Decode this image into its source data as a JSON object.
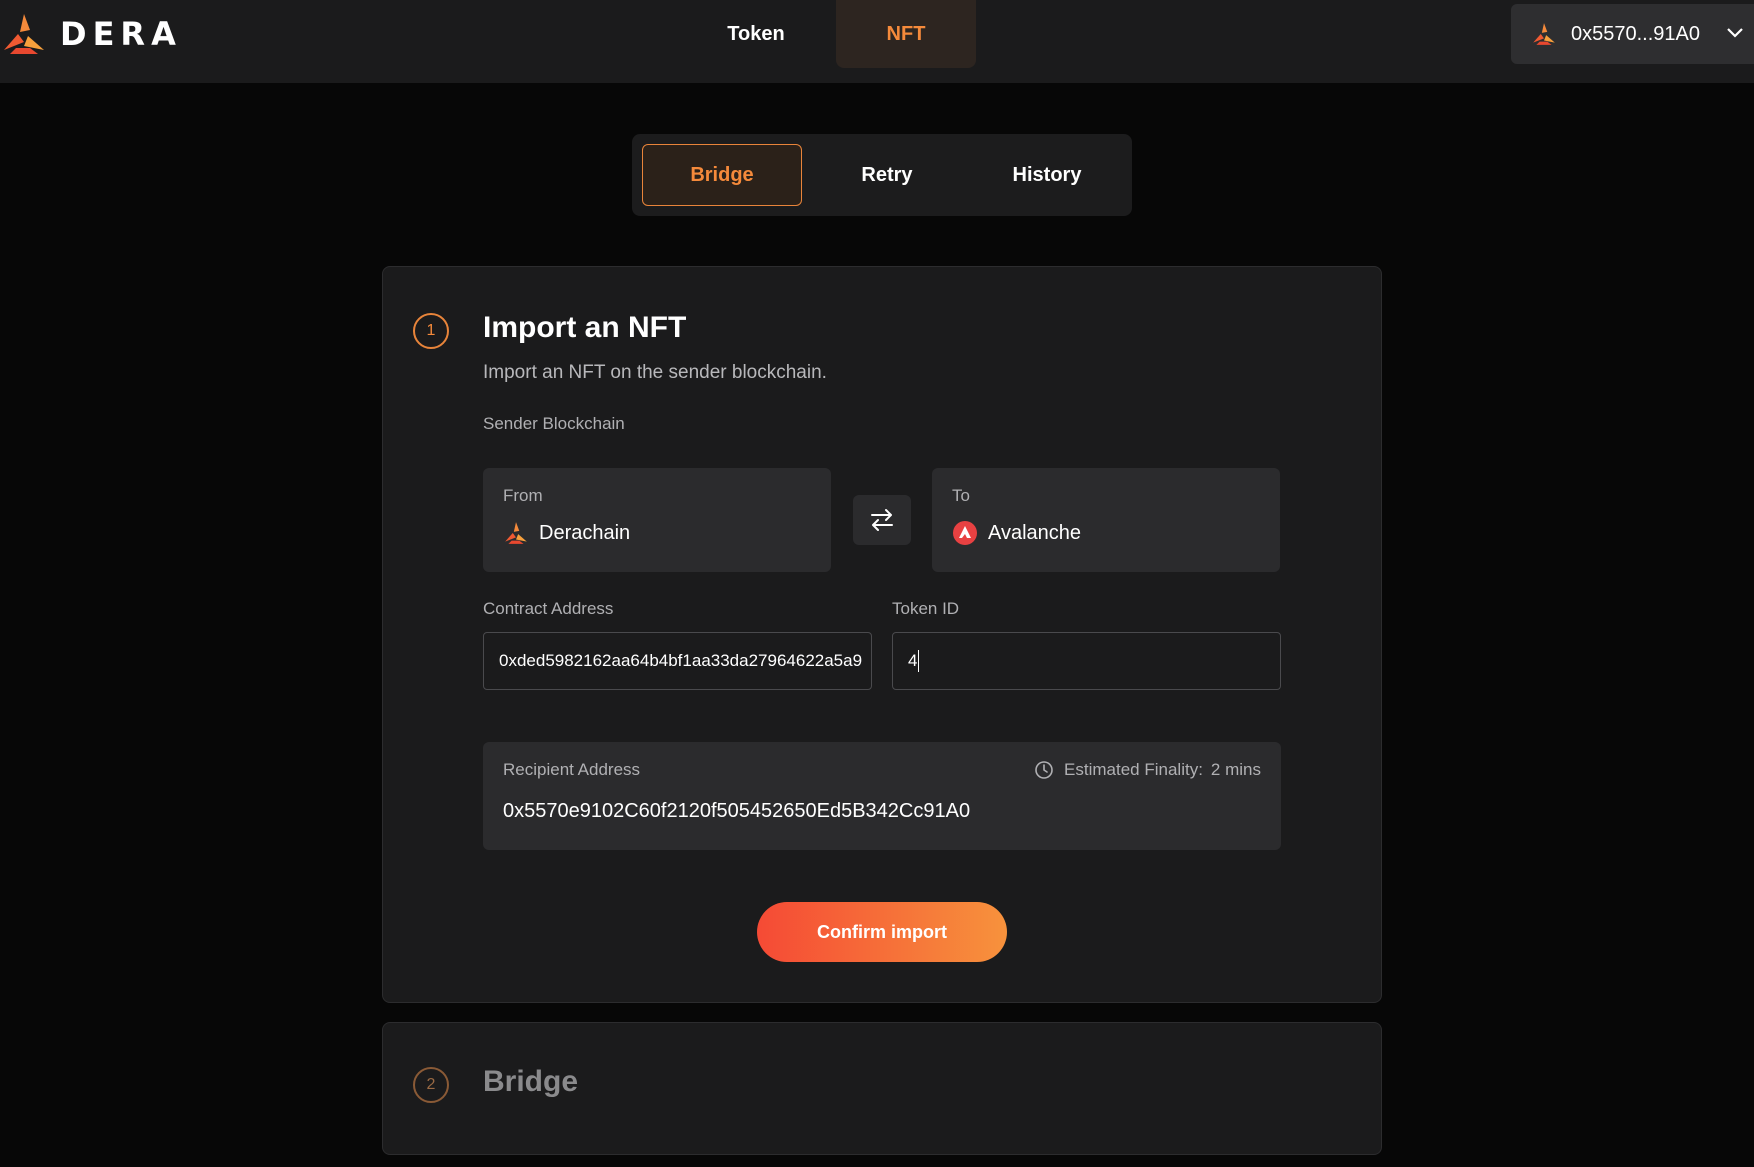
{
  "brand": {
    "name": "DERA"
  },
  "nav": {
    "tabs": [
      {
        "label": "Token",
        "active": false
      },
      {
        "label": "NFT",
        "active": true
      }
    ]
  },
  "wallet": {
    "address": "0x5570...91A0"
  },
  "mode_tabs": [
    {
      "label": "Bridge",
      "active": true
    },
    {
      "label": "Retry",
      "active": false
    },
    {
      "label": "History",
      "active": false
    }
  ],
  "step1": {
    "number": "1",
    "title": "Import an NFT",
    "subtitle": "Import an NFT on the sender blockchain.",
    "sender_label": "Sender Blockchain",
    "from": {
      "label": "From",
      "chain": "Derachain"
    },
    "to": {
      "label": "To",
      "chain": "Avalanche"
    },
    "contract": {
      "label": "Contract Address",
      "value": "0xded5982162aa64b4bf1aa33da27964622a5a9"
    },
    "token": {
      "label": "Token ID",
      "value": "4"
    },
    "recipient": {
      "label": "Recipient Address",
      "address": "0x5570e9102C60f2120f505452650Ed5B342Cc91A0",
      "finality_label": "Estimated Finality:",
      "finality_value": "2 mins"
    },
    "confirm_label": "Confirm import"
  },
  "step2": {
    "number": "2",
    "title": "Bridge"
  },
  "colors": {
    "accent": "#f58a3b",
    "background": "#070707",
    "card": "#1b1b1c",
    "avalanche_red": "#e84142"
  },
  "icons": {
    "logo": "dera-logo-icon",
    "chevron": "chevron-down-icon",
    "swap": "swap-arrows-icon",
    "clock": "clock-icon",
    "avalanche": "avalanche-icon"
  }
}
